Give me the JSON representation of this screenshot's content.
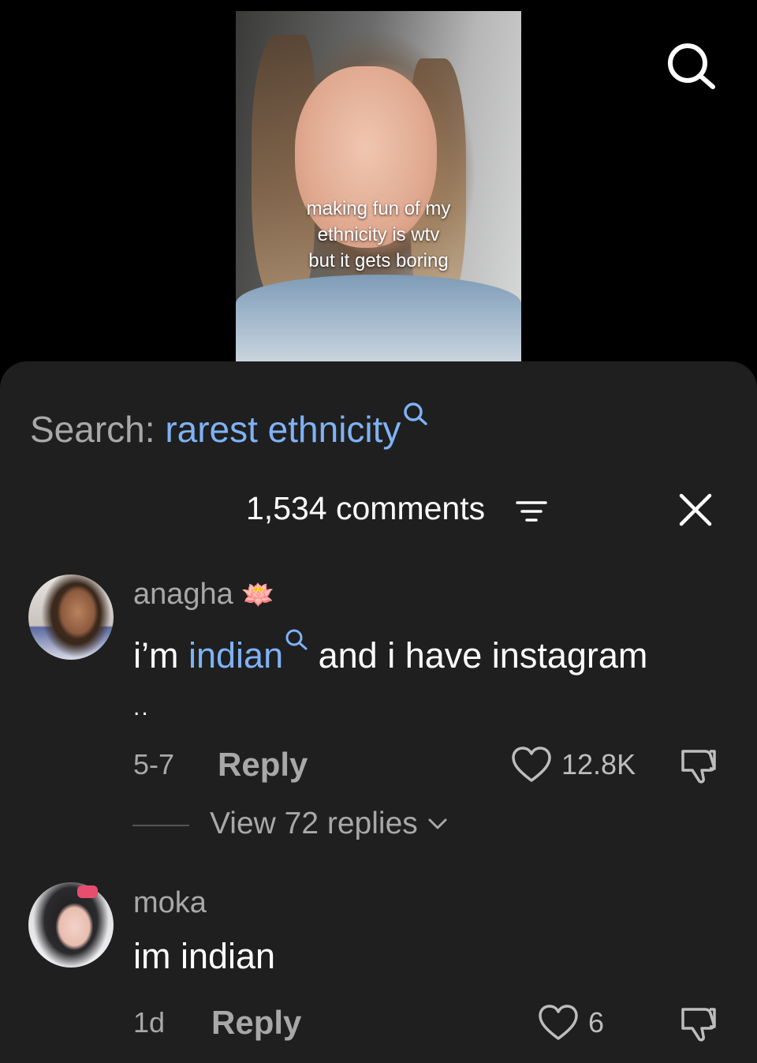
{
  "video": {
    "overlay_lines": [
      "making fun of my",
      "ethnicity is wtv",
      "but it gets boring"
    ]
  },
  "search": {
    "label": "Search:",
    "query": "rarest ethnicity"
  },
  "header": {
    "comment_count": "1,534 comments"
  },
  "comments": [
    {
      "username": "anagha",
      "emoji": "🪷",
      "text_before": "i’m",
      "text_link": "indian",
      "text_after": "and i have instagram",
      "text_line2": "..",
      "date": "5-7",
      "reply_label": "Reply",
      "likes": "12.8K",
      "view_replies": "View 72 replies"
    },
    {
      "username": "moka",
      "text": "im indian",
      "date": "1d",
      "reply_label": "Reply",
      "likes": "6"
    }
  ],
  "icons": {
    "top_search": "search-icon",
    "inline_search": "search-small-icon",
    "filter": "filter-icon",
    "close": "close-icon",
    "like": "heart-icon",
    "dislike": "thumbs-down-icon",
    "expand": "chevron-down-icon"
  },
  "colors": {
    "accent_link": "#7fb2f5",
    "sheet_bg": "#1f1f1f",
    "muted_text": "#a8a8a8"
  }
}
